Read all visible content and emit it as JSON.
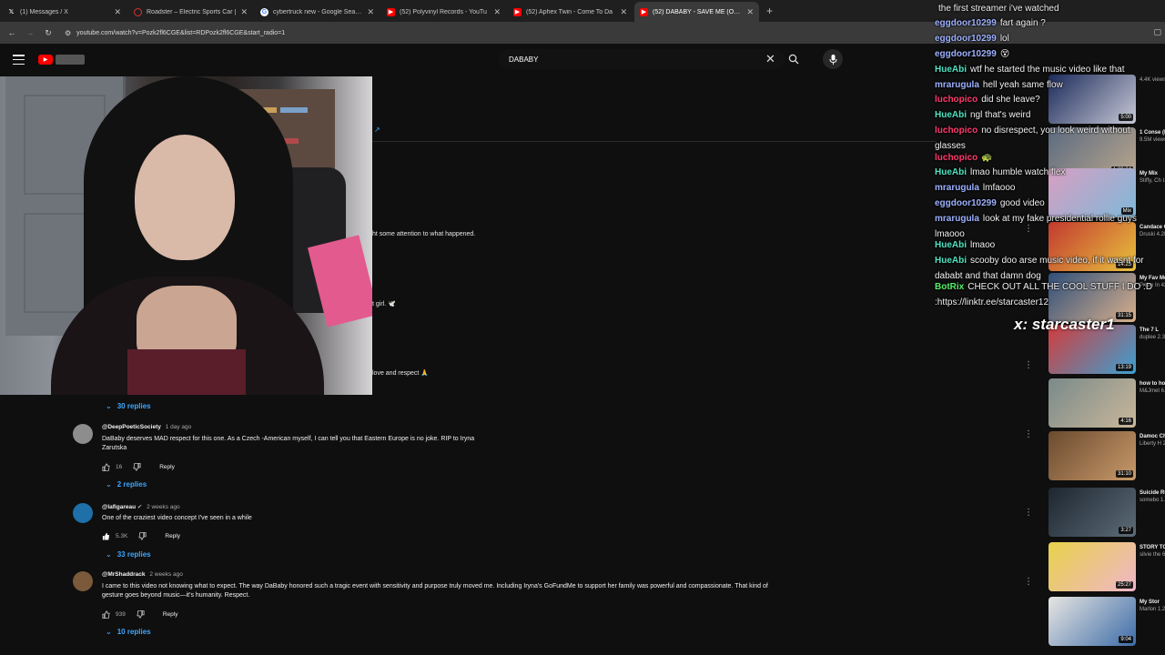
{
  "browser": {
    "tabs": [
      {
        "favicon": "x-logo-icon",
        "title": "(1) Messages / X",
        "active": false
      },
      {
        "favicon": "tesla-icon",
        "title": "Roadster – Electric Sports Car |",
        "active": false
      },
      {
        "favicon": "google-icon",
        "title": "cybertruck new - Google Search",
        "active": false
      },
      {
        "favicon": "youtube-icon",
        "title": "(52) Polyvinyl Records - YouTu",
        "active": false
      },
      {
        "favicon": "youtube-icon",
        "title": "(52) Aphex Twin - Come To Da",
        "active": false
      },
      {
        "favicon": "youtube-icon",
        "title": "(52) DABABY - SAVE ME (OFFIC",
        "active": true
      }
    ],
    "new_tab": "+",
    "url": "youtube.com/watch?v=Pozk2fl6CGE&list=RDPozk2fl6CGE&start_radio=1"
  },
  "youtube": {
    "search_value": "DABABY"
  },
  "chat": {
    "lines": [
      {
        "name": "",
        "text": "the first streamer i've watched",
        "color": "#ffffff"
      },
      {
        "name": "eggdoor10299",
        "text": "fart again ?",
        "color": "#9db1ff"
      },
      {
        "name": "eggdoor10299",
        "text": "lol",
        "color": "#9db1ff"
      },
      {
        "name": "eggdoor10299",
        "text": "😵",
        "color": "#9db1ff"
      },
      {
        "name": "HueAbi",
        "text": "wtf he started the music video like that",
        "color": "#4fe3c1"
      },
      {
        "name": "mrarugula",
        "text": "hell yeah same flow",
        "color": "#9db1ff"
      },
      {
        "name": "luchopico",
        "text": "did she leave?",
        "color": "#ff3c6e"
      },
      {
        "name": "HueAbi",
        "text": "ngl that's weird",
        "color": "#4fe3c1"
      },
      {
        "name": "luchopico",
        "text": "no disrespect, you look weird without glasses",
        "color": "#ff3c6e"
      },
      {
        "name": "luchopico",
        "text": "🐢",
        "color": "#ff3c6e"
      },
      {
        "name": "HueAbi",
        "text": "lmao humble watch flex",
        "color": "#4fe3c1"
      },
      {
        "name": "mrarugula",
        "text": "lmfaooo",
        "color": "#9db1ff"
      },
      {
        "name": "eggdoor10299",
        "text": "good video",
        "color": "#9db1ff"
      },
      {
        "name": "mrarugula",
        "text": "look at my fake presidential rollie guys lmaooo",
        "color": "#9db1ff"
      },
      {
        "name": "HueAbi",
        "text": "lmaoo",
        "color": "#4fe3c1"
      },
      {
        "name": "HueAbi",
        "text": "scooby doo arse music video, if it wasnt for dababt and that damn dog",
        "color": "#4fe3c1"
      },
      {
        "name": "BotRix",
        "text": "CHECK OUT ALL THE COOL STUFF I DO :D :https://linktr.ee/starcaster12",
        "color": "#58f06a"
      }
    ]
  },
  "watermark": "x: starcaster1",
  "recommendations": [
    {
      "title": "",
      "sub": "4.4K views",
      "duration": "5:00",
      "colors": [
        "#1c2a5a",
        "#c7c9d6"
      ]
    },
    {
      "title": "1 Conse (Ft. Car",
      "sub": "9.5M views",
      "duration": "1:30:24",
      "colors": [
        "#5a6a80",
        "#b8a58c"
      ]
    },
    {
      "title": "My Mix",
      "sub": "Stiffy, Ch Updated",
      "duration": "Mix",
      "colors": [
        "#d89fc2",
        "#7fb8d9"
      ]
    },
    {
      "title": "Candace Casting",
      "sub": "Druski 4.2M views",
      "duration": "14:25",
      "colors": [
        "#c23a2f",
        "#e9c23d"
      ]
    },
    {
      "title": "My Fav Momen",
      "sub": "Prism In 426K views",
      "duration": "31:15",
      "colors": [
        "#2f4f7a",
        "#d9b08c"
      ]
    },
    {
      "title": "The 7 L",
      "sub": "duplee 2.3M views",
      "duration": "13:19",
      "colors": [
        "#d23c3c",
        "#3ca0d2"
      ]
    },
    {
      "title": "how to home fi",
      "sub": "M&Jmet 6.1M views",
      "duration": "4:16",
      "colors": [
        "#7a8a8a",
        "#c9b79a"
      ]
    },
    {
      "title": "Damoc Charlie",
      "sub": "Liberty H 249K views",
      "duration": "31:10",
      "colors": [
        "#6a4a2f",
        "#c99a6a"
      ]
    },
    {
      "title": "Suicide Runnin'",
      "sub": "somebo 1.5M views",
      "duration": "3:27",
      "colors": [
        "#1d2630",
        "#5d6c78"
      ]
    },
    {
      "title": "STORY TOKYO",
      "sub": "silvie the 64K views New",
      "duration": "25:27",
      "colors": [
        "#e7d24a",
        "#f0b6c8"
      ]
    },
    {
      "title": "My Stor",
      "sub": "Marlon 1.2M views New",
      "duration": "9:04",
      "colors": [
        "#e8e6e2",
        "#3c6ca8"
      ]
    }
  ],
  "fragments": {
    "attention": "ht some attention to what happened.",
    "girl": "t girl. 🕊️",
    "respect": "love and respect 🙏"
  },
  "comments": [
    {
      "handle": "@DeepPoeticSociety",
      "time": "1 day ago",
      "text": "DaBaby deserves MAD respect for this one. As a Czech -American myself, I can tell you that Eastern Europe is no joke. RIP to Iryna Zarutska",
      "likes": "16",
      "reply": "Reply",
      "replies": "2 replies",
      "avatar_color": "#8d8d8d"
    },
    {
      "handle": "@lafigareau",
      "time": "2 weeks ago",
      "text": "One of the craziest video concept I've seen in a while",
      "likes": "5.3K",
      "reply": "Reply",
      "replies": "33 replies",
      "avatar_color": "#1f6fa8"
    },
    {
      "handle": "@MrShaddrack",
      "time": "2 weeks ago",
      "text": "I came to this video not knowing what to expect. The way DaBaby honored such a tragic event with sensitivity and purpose truly moved me. Including Iryna's GoFundMe to support her family was powerful and compassionate. That kind of gesture goes beyond music—it's humanity. Respect.",
      "likes": "939",
      "reply": "Reply",
      "replies": "10 replies",
      "avatar_color": "#7a5a3a"
    }
  ],
  "top_replies": "30 replies"
}
